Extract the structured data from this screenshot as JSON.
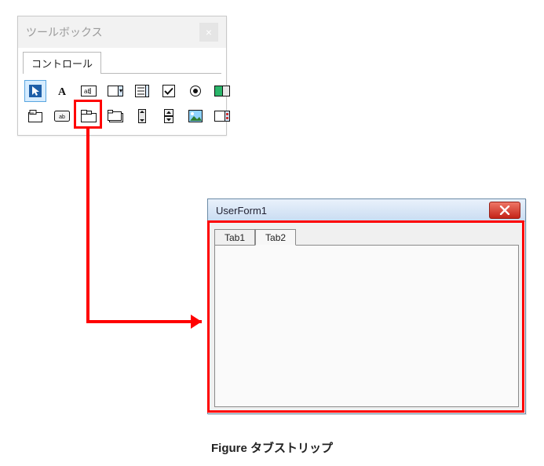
{
  "toolbox": {
    "title": "ツールボックス",
    "tab_label": "コントロール",
    "tools": [
      "pointer-icon",
      "label-icon",
      "textbox-icon",
      "combobox-icon",
      "listbox-icon",
      "checkbox-icon",
      "optionbutton-icon",
      "togglebutton-icon",
      "frame-icon",
      "commandbutton-icon",
      "tabstrip-icon",
      "multipage-icon",
      "scrollbar-icon",
      "spinbutton-icon",
      "image-icon",
      "refedit-icon"
    ]
  },
  "userform": {
    "title": "UserForm1",
    "tabs": [
      "Tab1",
      "Tab2"
    ]
  },
  "caption": "Figure タブストリップ"
}
